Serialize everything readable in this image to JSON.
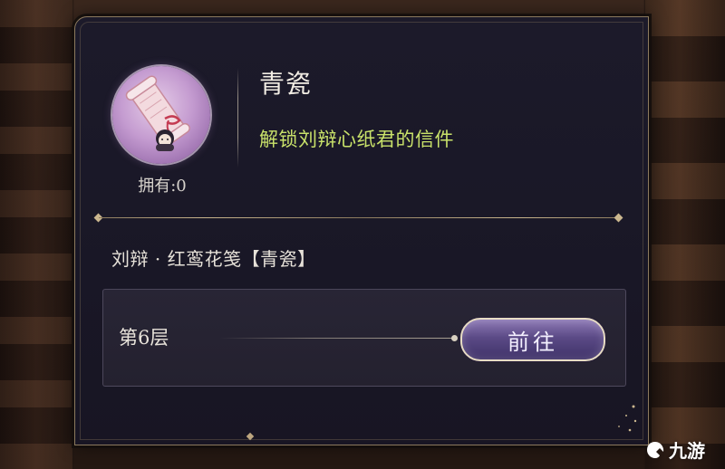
{
  "item": {
    "name": "青瓷",
    "description": "解锁刘辩心纸君的信件",
    "owned_text": "拥有:0",
    "icon": "scroll-letter-icon"
  },
  "source": {
    "label": "刘辩 · 红鸾花笺【青瓷】",
    "level_text": "第6层",
    "goto_label": "前往"
  },
  "watermark": {
    "text": "九游",
    "icon": "jiuyou-logo-icon"
  },
  "colors": {
    "panel_bg": "#1c1a2a",
    "description_green": "#c9e26a",
    "button_purple": "#5b4a86",
    "border_gold": "#8c7a5e"
  }
}
